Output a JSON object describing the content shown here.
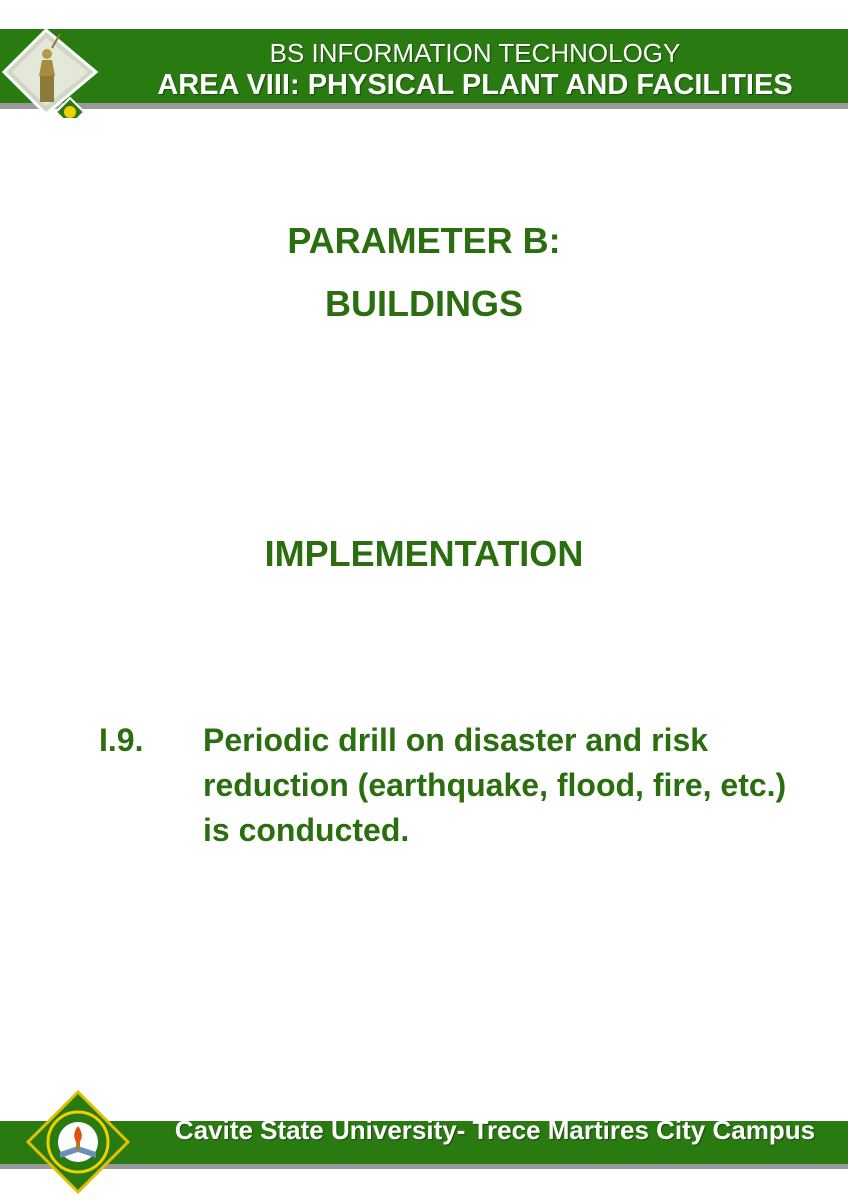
{
  "header": {
    "program": "BS INFORMATION TECHNOLOGY",
    "area": "AREA VIII: PHYSICAL PLANT AND FACILITIES"
  },
  "main": {
    "parameter": "PARAMETER B:",
    "parameter_name": "BUILDINGS",
    "section": "IMPLEMENTATION",
    "item_number": "I.9.",
    "item_text": "Periodic drill on disaster and risk reduction (earthquake, flood, fire, etc.) is conducted."
  },
  "footer": {
    "campus": "Cavite State University- Trece Martires City Campus"
  },
  "colors": {
    "brand_green": "#2a7a12",
    "text_green": "#2a6e10"
  },
  "icons": {
    "header_logo": "statue-emblem-logo",
    "footer_logo": "university-seal-logo"
  }
}
